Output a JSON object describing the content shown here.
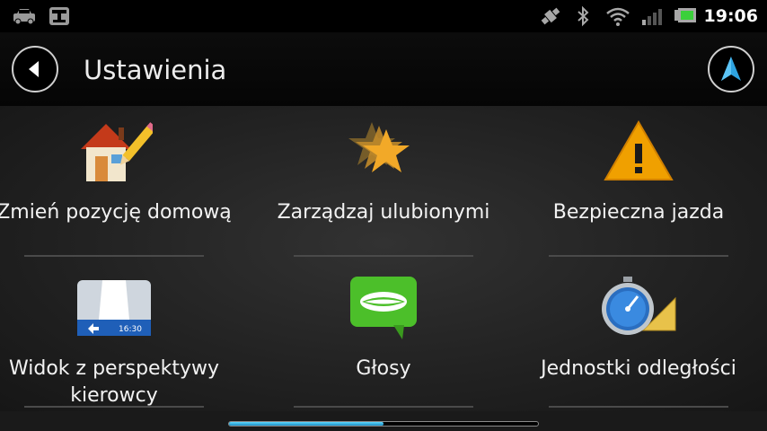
{
  "status_bar": {
    "time": "19:06",
    "icons": [
      "car-icon",
      "map-pin-icon",
      "gps-satellite-icon",
      "bluetooth-icon",
      "wifi-icon",
      "signal-icon",
      "battery-icon"
    ]
  },
  "header": {
    "title": "Ustawienia",
    "back_icon": "back-arrow-icon",
    "nav_icon": "navigation-arrow-icon"
  },
  "menu": {
    "items": [
      {
        "label": "Zmień pozycję domową",
        "icon": "home-pencil-icon"
      },
      {
        "label": "Zarządzaj ulubionymi",
        "icon": "favorites-star-icon"
      },
      {
        "label": "Bezpieczna jazda",
        "icon": "warning-triangle-icon"
      },
      {
        "label": "Widok z perspektywy kierowcy",
        "icon": "driver-view-icon",
        "badge": "16:30"
      },
      {
        "label": "Głosy",
        "icon": "voices-lips-icon"
      },
      {
        "label": "Jednostki odległości",
        "icon": "stopwatch-ruler-icon"
      }
    ]
  },
  "scroll": {
    "position_fraction": 0.5
  },
  "colors": {
    "accent": "#22b1e6",
    "background": "#1a1a1a",
    "warning": "#f0a000",
    "voices_green": "#4cbf2a"
  }
}
